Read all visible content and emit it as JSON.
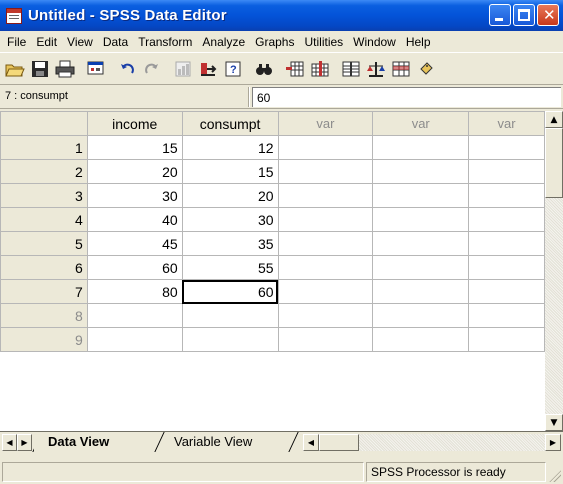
{
  "window": {
    "title": "Untitled - SPSS Data Editor"
  },
  "menu": [
    "File",
    "Edit",
    "View",
    "Data",
    "Transform",
    "Analyze",
    "Graphs",
    "Utilities",
    "Window",
    "Help"
  ],
  "toolbar": {
    "buttons": [
      {
        "name": "open-icon"
      },
      {
        "name": "save-icon"
      },
      {
        "name": "print-icon"
      },
      {
        "name": "dialog-recall-icon"
      },
      {
        "name": "undo-icon"
      },
      {
        "name": "redo-icon"
      },
      {
        "name": "goto-chart-icon"
      },
      {
        "name": "goto-case-icon"
      },
      {
        "name": "variables-icon"
      },
      {
        "name": "find-icon"
      },
      {
        "name": "insert-cases-icon"
      },
      {
        "name": "insert-variable-icon"
      },
      {
        "name": "split-file-icon"
      },
      {
        "name": "weight-cases-icon"
      },
      {
        "name": "select-cases-icon"
      },
      {
        "name": "value-labels-icon"
      }
    ]
  },
  "cell_editor": {
    "reference": "7 : consumpt",
    "value": "60"
  },
  "grid": {
    "columns": [
      "income",
      "consumpt",
      "var",
      "var",
      "var"
    ],
    "active_columns": 2,
    "rows": [
      {
        "n": "1",
        "cells": [
          "15",
          "12"
        ]
      },
      {
        "n": "2",
        "cells": [
          "20",
          "15"
        ]
      },
      {
        "n": "3",
        "cells": [
          "30",
          "20"
        ]
      },
      {
        "n": "4",
        "cells": [
          "40",
          "30"
        ]
      },
      {
        "n": "5",
        "cells": [
          "45",
          "35"
        ]
      },
      {
        "n": "6",
        "cells": [
          "60",
          "55"
        ]
      },
      {
        "n": "7",
        "cells": [
          "80",
          "60"
        ]
      },
      {
        "n": "8",
        "cells": [
          "",
          ""
        ]
      },
      {
        "n": "9",
        "cells": [
          "",
          ""
        ]
      }
    ],
    "selected": {
      "row": "7",
      "column": "consumpt"
    }
  },
  "tabs": {
    "data_view": "Data View",
    "variable_view": "Variable View"
  },
  "status": {
    "processor": "SPSS Processor  is ready"
  }
}
